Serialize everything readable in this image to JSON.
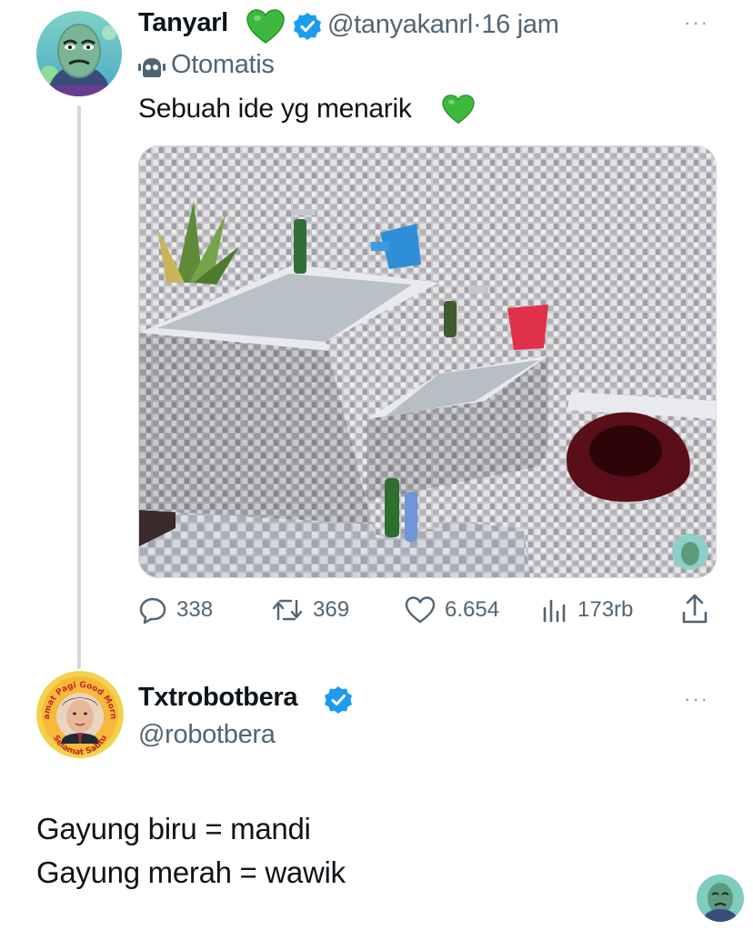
{
  "tweet": {
    "author_name": "Tanyarl",
    "author_handle": "@tanyakanrl",
    "separator": "·",
    "time_ago": "16 jam",
    "automated_label": "Otomatis",
    "text": "Sebuah ide yg menarik",
    "more_label": "···",
    "stats": {
      "replies": "338",
      "retweets": "369",
      "likes": "6.654",
      "views": "173rb"
    }
  },
  "reply": {
    "author_name": "Txtrobotbera",
    "author_handle": "@robotbera",
    "more_label": "···",
    "lines": [
      "Gayung biru = mandi",
      "Gayung merah = wawik"
    ]
  },
  "avatar2_badge_text": "Selamat Pagi Good Morning Selamat Sabtu",
  "icons": {
    "heart_emoji": "green-heart-icon",
    "verified": "verified-badge-icon",
    "automated": "bot-icon",
    "reply": "reply-icon",
    "retweet": "retweet-icon",
    "like": "like-icon",
    "views": "views-icon",
    "share": "share-icon"
  },
  "colors": {
    "verified_blue": "#1d9bf0",
    "secondary_text": "#536471",
    "thread_line": "#cfd9de",
    "heart_green": "#3cb93c"
  }
}
